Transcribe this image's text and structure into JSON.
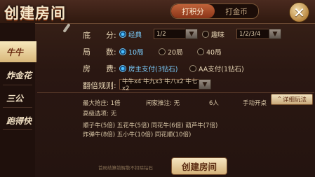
{
  "header": {
    "title": "创建房间",
    "tabs": [
      {
        "label": "打积分",
        "active": true
      },
      {
        "label": "打金币",
        "active": false
      }
    ],
    "close_icon": "close-x-icon"
  },
  "sidebar": {
    "items": [
      {
        "label": "牛牛",
        "active": true
      },
      {
        "label": "炸金花",
        "active": false
      },
      {
        "label": "三公",
        "active": false
      },
      {
        "label": "跑得快",
        "active": false
      }
    ]
  },
  "form": {
    "base_score": {
      "label": "底　　分:",
      "classic_label": "经典",
      "classic_value": "1/2",
      "fun_label": "趣味",
      "fun_value": "1/2/3/4",
      "selected": "classic"
    },
    "rounds": {
      "label": "局　　数:",
      "options": [
        "10局",
        "20局",
        "40局"
      ],
      "selected": "10局"
    },
    "room_fee": {
      "label": "房　　费:",
      "options": [
        "房主支付(3钻石)",
        "AA支付(1钻石)"
      ],
      "selected": "房主支付(3钻石)"
    },
    "multiplier": {
      "label": "翻倍规则:",
      "value": "牛牛x4 牛九x3 牛八x2 牛七x2"
    }
  },
  "info": {
    "max_bet": "最大抢庄:  1倍",
    "idle_push": "闲家推注:  无",
    "players": "6人",
    "manual_start": "手动开桌",
    "advanced": "高级选项:  无",
    "detail_button": "详细玩法",
    "special_line1": "顺子牛(5倍)  五花牛(5倍)  同花牛(6倍)  葫芦牛(7倍)",
    "special_line2": "炸弹牛(8倍)  五小牛(10倍)  同花顺(10倍)"
  },
  "footer": {
    "note": "首局结算前解散不扣除钻石",
    "create_button": "创建房间"
  },
  "colors": {
    "accent_blue": "#4cc0ff",
    "tab_active": "#b8552e",
    "button_gold": "#d6b37a"
  }
}
